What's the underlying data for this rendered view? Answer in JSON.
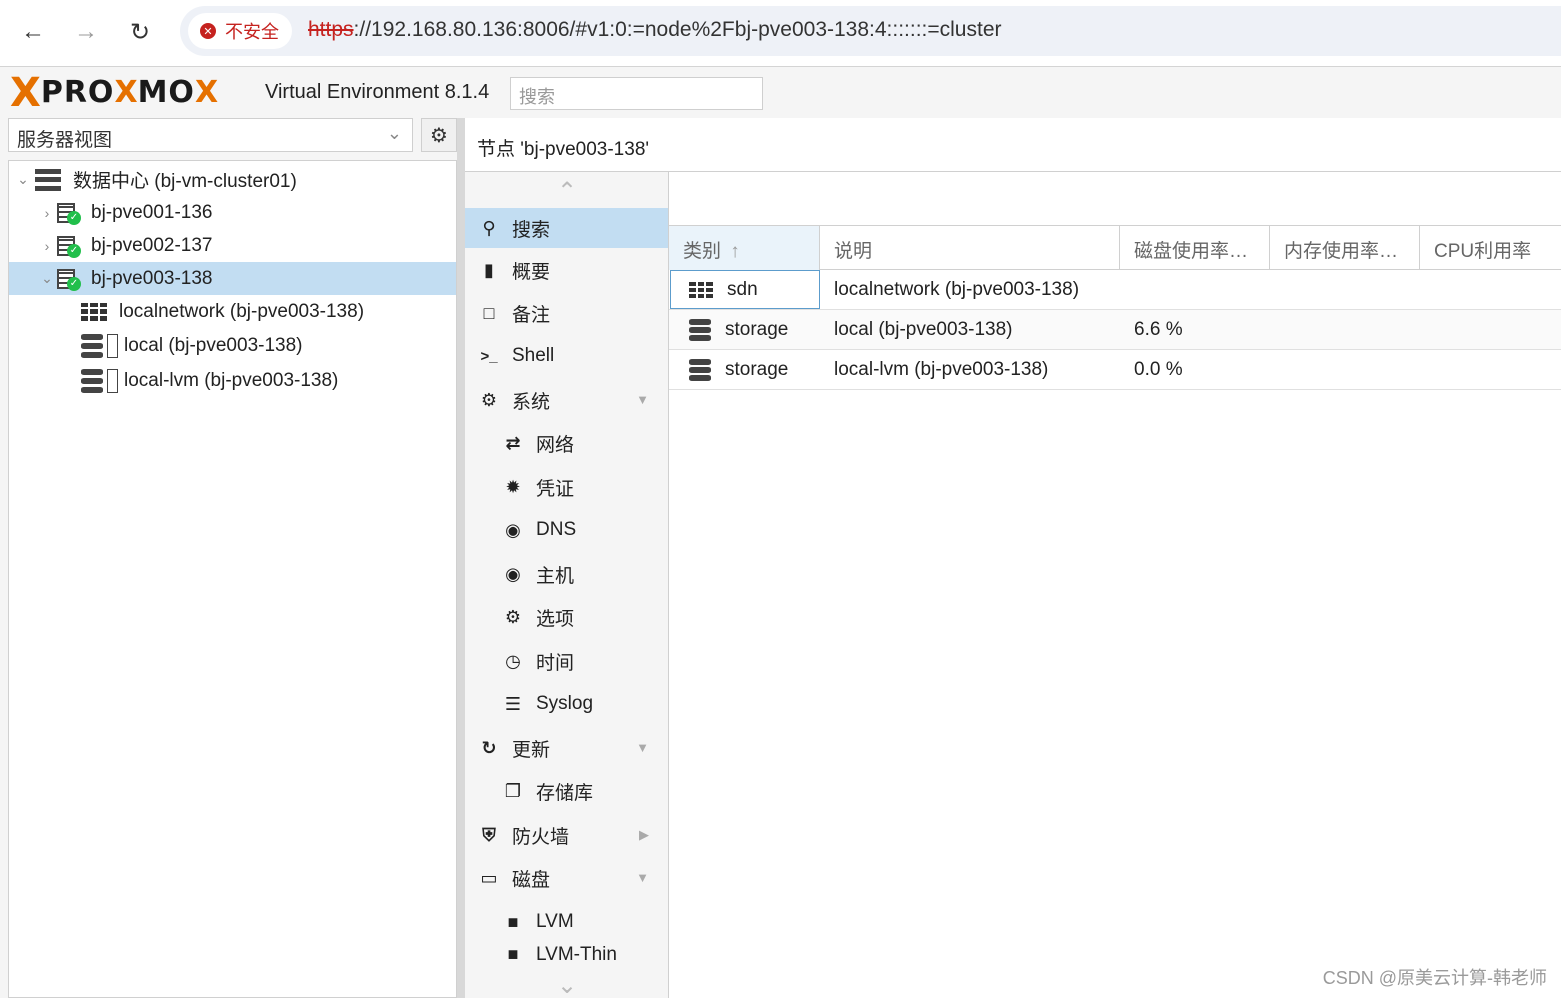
{
  "browser": {
    "security_label": "不安全",
    "url_scheme": "https",
    "url_rest": "://192.168.80.136:8006/#v1:0:=node%2Fbj-pve003-138:4:::::::=cluster"
  },
  "header": {
    "logo_x": "X",
    "logo_word_1": "PRO",
    "logo_x2": "X",
    "logo_word_2": "MO",
    "logo_x3": "X",
    "version": "Virtual Environment 8.1.4",
    "search_placeholder": "搜索"
  },
  "left": {
    "view_select": "服务器视图",
    "tree": [
      {
        "label": "数据中心 (bj-vm-cluster01)",
        "icon": "datacenter-icon"
      },
      {
        "label": "bj-pve001-136",
        "icon": "node-online-icon"
      },
      {
        "label": "bj-pve002-137",
        "icon": "node-online-icon"
      },
      {
        "label": "bj-pve003-138",
        "icon": "node-online-icon",
        "selected": true
      },
      {
        "label": "localnetwork (bj-pve003-138)",
        "icon": "sdn-grid-icon"
      },
      {
        "label": "local (bj-pve003-138)",
        "icon": "storage-icon"
      },
      {
        "label": "local-lvm (bj-pve003-138)",
        "icon": "storage-icon"
      }
    ]
  },
  "content": {
    "title": "节点 'bj-pve003-138'",
    "menu": [
      {
        "label": "搜索",
        "icon": "search-icon",
        "active": true
      },
      {
        "label": "概要",
        "icon": "book-icon"
      },
      {
        "label": "备注",
        "icon": "note-icon"
      },
      {
        "label": "Shell",
        "icon": "terminal-icon"
      },
      {
        "label": "系统",
        "icon": "cogs-icon"
      },
      {
        "label": "网络",
        "icon": "exchange-icon"
      },
      {
        "label": "凭证",
        "icon": "certificate-icon"
      },
      {
        "label": "DNS",
        "icon": "globe-icon"
      },
      {
        "label": "主机",
        "icon": "globe-icon"
      },
      {
        "label": "选项",
        "icon": "gear-icon"
      },
      {
        "label": "时间",
        "icon": "clock-icon"
      },
      {
        "label": "Syslog",
        "icon": "list-icon"
      },
      {
        "label": "更新",
        "icon": "refresh-icon"
      },
      {
        "label": "存储库",
        "icon": "copy-icon"
      },
      {
        "label": "防火墙",
        "icon": "shield-icon"
      },
      {
        "label": "磁盘",
        "icon": "hdd-icon"
      },
      {
        "label": "LVM",
        "icon": "square-icon"
      },
      {
        "label": "LVM-Thin",
        "icon": "square-icon"
      }
    ],
    "grid": {
      "columns": [
        "类别",
        "说明",
        "磁盘使用率…",
        "内存使用率…",
        "CPU利用率"
      ],
      "sort_indicator": "↑",
      "rows": [
        {
          "type": "sdn",
          "desc": "localnetwork (bj-pve003-138)",
          "disk": "",
          "mem": "",
          "cpu": ""
        },
        {
          "type": "storage",
          "desc": "local (bj-pve003-138)",
          "disk": "6.6 %",
          "mem": "",
          "cpu": ""
        },
        {
          "type": "storage",
          "desc": "local-lvm (bj-pve003-138)",
          "disk": "0.0 %",
          "mem": "",
          "cpu": ""
        }
      ]
    }
  },
  "watermark": "CSDN @原美云计算-韩老师"
}
